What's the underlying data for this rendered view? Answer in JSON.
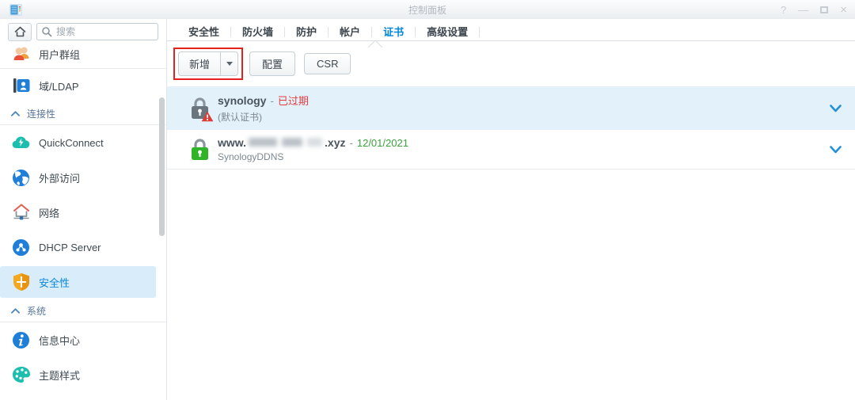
{
  "window": {
    "title": "控制面板",
    "controls": {
      "help": "?",
      "minimize": "—",
      "close": "×"
    }
  },
  "sidebar": {
    "search": {
      "placeholder": "搜索"
    },
    "groups": [
      {
        "items": [
          {
            "label": "用户群组"
          },
          {
            "label": "域/LDAP"
          }
        ]
      },
      {
        "header": "连接性",
        "items": [
          {
            "label": "QuickConnect"
          },
          {
            "label": "外部访问"
          },
          {
            "label": "网络"
          },
          {
            "label": "DHCP Server"
          },
          {
            "label": "安全性"
          }
        ]
      },
      {
        "header": "系统",
        "items": [
          {
            "label": "信息中心"
          },
          {
            "label": "主题样式"
          }
        ]
      }
    ],
    "selected_item": "安全性"
  },
  "tabs": {
    "items": [
      {
        "label": "安全性"
      },
      {
        "label": "防火墙"
      },
      {
        "label": "防护"
      },
      {
        "label": "帐户"
      },
      {
        "label": "证书"
      },
      {
        "label": "高级设置"
      }
    ],
    "selected": "证书"
  },
  "toolbar": {
    "add_label": "新增",
    "configure_label": "配置",
    "csr_label": "CSR"
  },
  "certificates": [
    {
      "name": "synology",
      "separator": "-",
      "status": "已过期",
      "description": "(默认证书)"
    },
    {
      "name_prefix": "www.",
      "name_suffix": ".xyz",
      "separator": "-",
      "valid_until": "12/01/2021",
      "description": "SynologyDDNS",
      "domain_hidden": true
    }
  ],
  "colors": {
    "accent_blue": "#0087d8",
    "expired_red": "#e03e3e",
    "valid_green": "#3da03d",
    "annotation_red": "#e4211b",
    "selected_row_bg": "#e3f1fb",
    "sidebar_selected_bg": "#d8ecf9"
  }
}
